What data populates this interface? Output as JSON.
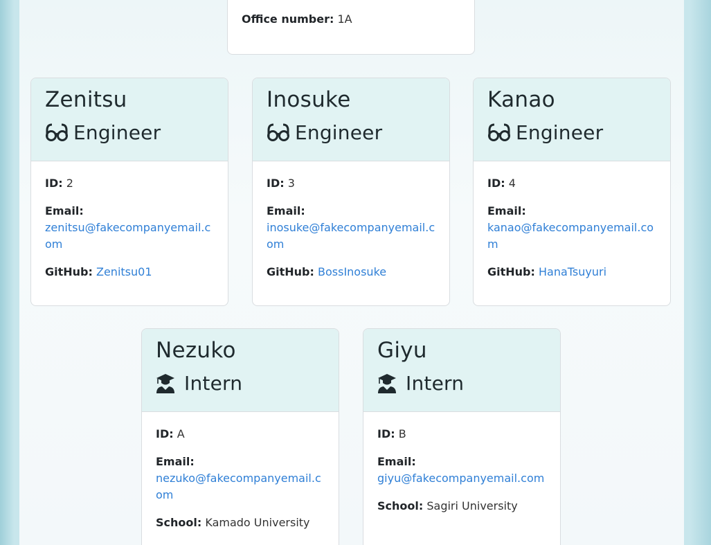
{
  "manager": {
    "office_label": "Office number:",
    "office_value": "1A"
  },
  "labels": {
    "id": "ID:",
    "email": "Email:",
    "github": "GitHub:",
    "school": "School:"
  },
  "icons": {
    "engineer": "glasses-icon",
    "intern": "graduate-icon"
  },
  "employees": [
    {
      "name": "Zenitsu",
      "role": "Engineer",
      "id": "2",
      "email": "zenitsu@fakecompanyemail.com",
      "github": "Zenitsu01"
    },
    {
      "name": "Inosuke",
      "role": "Engineer",
      "id": "3",
      "email": "inosuke@fakecompanyemail.com",
      "github": "BossInosuke"
    },
    {
      "name": "Kanao",
      "role": "Engineer",
      "id": "4",
      "email": "kanao@fakecompanyemail.com",
      "github": "HanaTsuyuri"
    },
    {
      "name": "Nezuko",
      "role": "Intern",
      "id": "A",
      "email": "nezuko@fakecompanyemail.com",
      "school": "Kamado University"
    },
    {
      "name": "Giyu",
      "role": "Intern",
      "id": "B",
      "email": "giyu@fakecompanyemail.com",
      "school": "Sagiri University"
    }
  ]
}
